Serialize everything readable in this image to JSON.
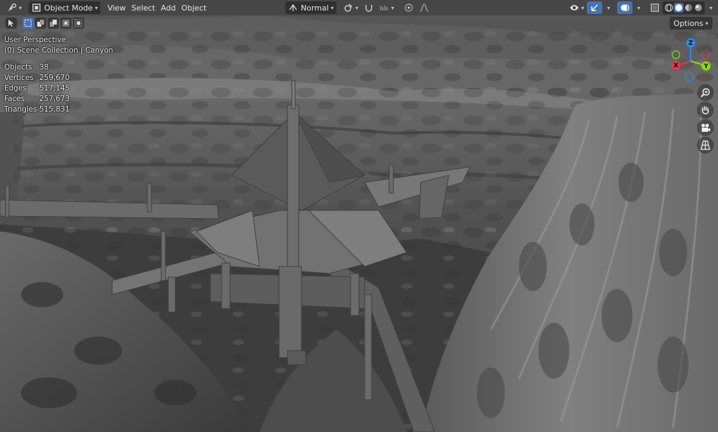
{
  "header": {
    "mode_label": "Object Mode",
    "menus": [
      "View",
      "Select",
      "Add",
      "Object"
    ],
    "orientation_label": "Normal"
  },
  "options_label": "Options",
  "viewport_info": {
    "perspective": "User Perspective",
    "collection": "(0) Scene Collection | Canyon"
  },
  "stats": [
    {
      "label": "Objects",
      "value": "38"
    },
    {
      "label": "Vertices",
      "value": "259,670"
    },
    {
      "label": "Edges",
      "value": "517,145"
    },
    {
      "label": "Faces",
      "value": "257,673"
    },
    {
      "label": "Triangles",
      "value": "515,831"
    }
  ],
  "gizmo": {
    "x": "X",
    "y": "Y",
    "z": "Z"
  },
  "colors": {
    "accent": "#4772b3",
    "axis_x": "#e8364e",
    "axis_y": "#8bdc00",
    "axis_z": "#2d8ceb"
  },
  "icons": {
    "editor_type": "transform-cursor-icon",
    "mode": "object-mode-icon",
    "orientation": "orientation-icon",
    "pivot": "pivot-icon",
    "snap": "magnet-icon",
    "snap_increment": "snap-increment-icon",
    "proportional": "proportional-edit-icon",
    "falloff": "falloff-icon",
    "visibility": "eye-icon",
    "gizmo": "gizmo-icon",
    "overlays": "overlays-icon",
    "xray": "xray-icon",
    "shading": [
      "wireframe-icon",
      "solid-icon",
      "material-icon",
      "rendered-icon"
    ],
    "nav": [
      "zoom-icon",
      "hand-icon",
      "camera-icon",
      "grid-icon"
    ]
  }
}
